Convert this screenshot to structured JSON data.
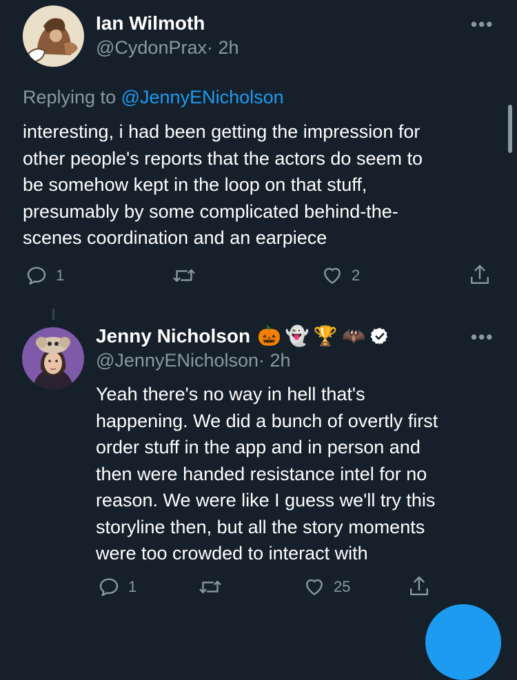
{
  "colors": {
    "background": "#15202b",
    "text": "#ffffff",
    "muted": "#8b98a5",
    "link": "#1d9bf0",
    "fab": "#1d9bf0"
  },
  "tweet1": {
    "name": "Ian Wilmoth",
    "handle": "@CydonPrax",
    "time": "· 2h",
    "replying_prefix": "Replying to",
    "replying_to": "@JennyENicholson",
    "body": [
      "interesting, i had been getting the impression for",
      "other people's reports that the actors do seem to",
      "be somehow kept in the loop on that stuff,",
      "presumably by some complicated behind-the-",
      "scenes coordination and an earpiece"
    ],
    "replies": "1",
    "retweets": "",
    "likes": "2"
  },
  "tweet2": {
    "name": "Jenny Nicholson",
    "emojis": [
      "🎃",
      "👻",
      "🏆",
      "🦇"
    ],
    "verified": true,
    "handle": "@JennyENicholson",
    "time": "· 2h",
    "body": [
      "Yeah there's no way in hell that's",
      "happening. We did a bunch of overtly first",
      "order stuff in the app and in person and",
      "then were handed resistance intel for no",
      "reason. We were like I guess we'll try this",
      "storyline then, but all the story moments",
      "were too crowded to interact with"
    ],
    "replies": "1",
    "retweets": "",
    "likes": "25"
  },
  "icons": {
    "more": "more-horizontal-icon",
    "reply": "reply-icon",
    "retweet": "retweet-icon",
    "like": "heart-icon",
    "share": "share-icon",
    "verified": "verified-badge-icon"
  },
  "more_label": "•••"
}
